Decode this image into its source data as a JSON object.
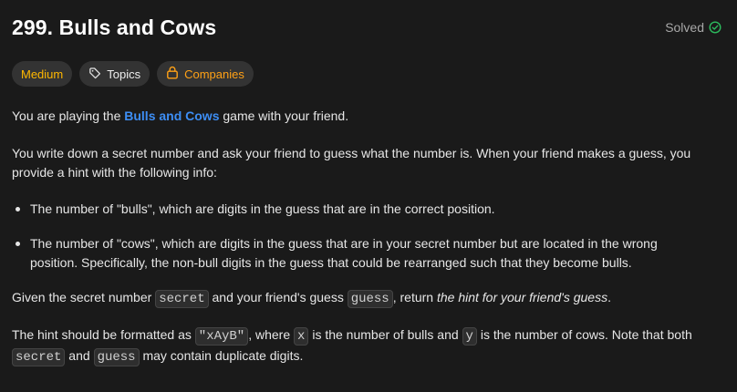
{
  "problem": {
    "title": "299. Bulls and Cows",
    "status": "Solved"
  },
  "tags": {
    "difficulty": "Medium",
    "topics": "Topics",
    "companies": "Companies"
  },
  "description": {
    "p1_before": "You are playing the ",
    "p1_link": "Bulls and Cows",
    "p1_after": " game with your friend.",
    "p2": "You write down a secret number and ask your friend to guess what the number is. When your friend makes a guess, you provide a hint with the following info:",
    "bullets": [
      "The number of \"bulls\", which are digits in the guess that are in the correct position.",
      "The number of \"cows\", which are digits in the guess that are in your secret number but are located in the wrong position. Specifically, the non-bull digits in the guess that could be rearranged such that they become bulls."
    ],
    "p3_a": "Given the secret number ",
    "p3_code1": "secret",
    "p3_b": " and your friend's guess ",
    "p3_code2": "guess",
    "p3_c": ", return ",
    "p3_em": "the hint for your friend's guess",
    "p3_d": ".",
    "p4_a": "The hint should be formatted as ",
    "p4_code1": "\"xAyB\"",
    "p4_b": ", where ",
    "p4_code2": "x",
    "p4_c": " is the number of bulls and ",
    "p4_code3": "y",
    "p4_d": " is the number of cows. Note that both ",
    "p4_code4": "secret",
    "p4_e": " and ",
    "p4_code5": "guess",
    "p4_f": " may contain duplicate digits."
  },
  "colors": {
    "background": "#1a1a1a",
    "medium": "#ffb800",
    "link": "#3d8ef5",
    "solved_check": "#2cbb5d"
  }
}
